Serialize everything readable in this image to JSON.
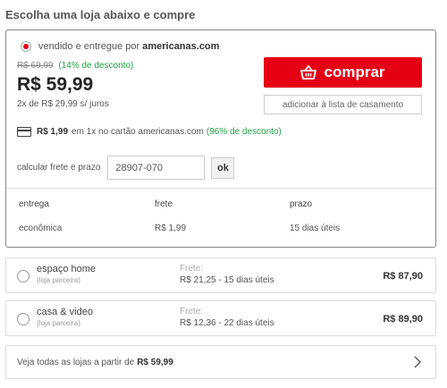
{
  "heading": "Escolha uma loja abaixo e compre",
  "selected_offer": {
    "seller_prefix": "vendido e entregue por",
    "seller_name": "americanas.com",
    "old_price": "R$ 69,99",
    "discount": "(14% de desconto)",
    "price": "R$ 59,99",
    "installments": "2x de R$ 29,99 s/ juros",
    "buy_label": "comprar",
    "registry_label": "adicionar à lista de casamento",
    "card_offer": {
      "price": "R$ 1,99",
      "text": "em 1x no cartão americanas.com",
      "discount": "(96% de desconto)"
    },
    "freight": {
      "label": "calcular frete e prazo",
      "cep_value": "28907-070",
      "ok_label": "ok"
    },
    "shipping_table": {
      "headers": [
        "entrega",
        "frete",
        "prazo"
      ],
      "row": [
        "econômica",
        "R$ 1,99",
        "15 dias úteis"
      ]
    }
  },
  "other_sellers": [
    {
      "name": "espaço home",
      "type": "(loja parceira)",
      "freight_label": "Frete:",
      "freight_info": "R$ 21,25 - 15 dias úteis",
      "price": "R$ 87,90"
    },
    {
      "name": "casa & video",
      "type": "(loja parceira)",
      "freight_label": "Frete:",
      "freight_info": "R$ 12,36 - 22 dias úteis",
      "price": "R$ 89,90"
    }
  ],
  "see_all": {
    "text": "Veja todas as lojas a partir de",
    "price": "R$ 59,99"
  },
  "colors": {
    "accent": "#e60014",
    "discount_green": "#22a042",
    "border": "#dddddd"
  },
  "icons": [
    "basket-icon",
    "credit-card-icon",
    "chevron-right-icon"
  ]
}
